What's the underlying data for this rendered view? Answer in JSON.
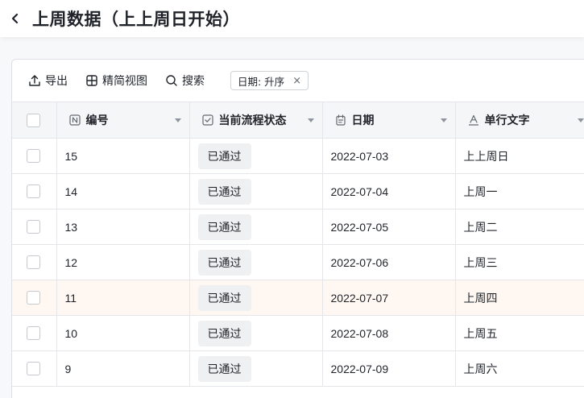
{
  "header": {
    "title": "上周数据（上上周日开始）"
  },
  "toolbar": {
    "export_label": "导出",
    "view_label": "精简视图",
    "search_label": "搜索",
    "sort_chip": "日期: 升序",
    "sort_close": "×"
  },
  "columns": {
    "id": "编号",
    "status": "当前流程状态",
    "date": "日期",
    "text": "单行文字"
  },
  "rows": [
    {
      "id": "15",
      "status": "已通过",
      "date": "2022-07-03",
      "text": "上上周日"
    },
    {
      "id": "14",
      "status": "已通过",
      "date": "2022-07-04",
      "text": "上周一"
    },
    {
      "id": "13",
      "status": "已通过",
      "date": "2022-07-05",
      "text": "上周二"
    },
    {
      "id": "12",
      "status": "已通过",
      "date": "2022-07-06",
      "text": "上周三"
    },
    {
      "id": "11",
      "status": "已通过",
      "date": "2022-07-07",
      "text": "上周四"
    },
    {
      "id": "10",
      "status": "已通过",
      "date": "2022-07-08",
      "text": "上周五"
    },
    {
      "id": "9",
      "status": "已通过",
      "date": "2022-07-09",
      "text": "上周六"
    }
  ],
  "icons": {
    "back": "chevron-left-icon",
    "export": "upload-icon",
    "view": "grid-icon",
    "search": "search-icon",
    "id_col": "number-field-icon",
    "status_col": "checkbox-field-icon",
    "date_col": "calendar-icon",
    "text_col": "text-field-icon"
  },
  "colors": {
    "highlight_row": "#fff8f2",
    "badge_bg": "#eff0f1"
  }
}
